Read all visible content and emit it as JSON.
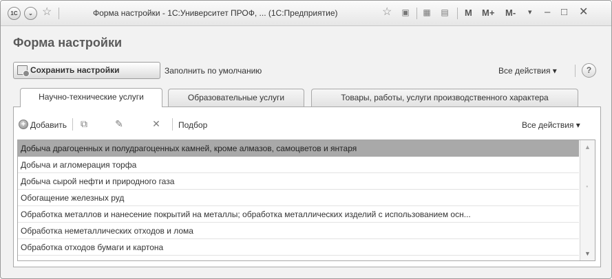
{
  "window": {
    "title": "Форма настройки - 1С:Университет ПРОФ, ... (1С:Предприятие)",
    "logo_text": "1C",
    "icons": [
      "menu-circle-icon",
      "favorite-star-icon",
      "favorite-star-outline-icon",
      "bookmark-icon",
      "calculator-icon",
      "calendar-icon"
    ],
    "memory_buttons": [
      "M",
      "M+",
      "M-"
    ],
    "controls": [
      "dropdown-arrow",
      "minimize",
      "maximize",
      "close"
    ]
  },
  "form": {
    "title": "Форма настройки",
    "save_label": "Сохранить настройки",
    "fill_default_label": "Заполнить по умолчанию",
    "all_actions_label": "Все действия ▾",
    "help_label": "?"
  },
  "tabs": [
    {
      "label": "Научно-технические услуги",
      "active": true
    },
    {
      "label": "Образовательные услуги",
      "active": false
    },
    {
      "label": "Товары, работы, услуги производственного характера",
      "active": false
    }
  ],
  "panel": {
    "add_label": "Добавить",
    "selection_label": "Подбор",
    "all_actions_label": "Все действия ▾"
  },
  "list": {
    "items": [
      {
        "label": "Добыча драгоценных и полудрагоценных камней, кроме алмазов,  самоцветов и янтаря",
        "selected": true
      },
      {
        "label": "Добыча и агломерация торфа",
        "selected": false
      },
      {
        "label": "Добыча сырой нефти и природного газа",
        "selected": false
      },
      {
        "label": "Обогащение железных руд",
        "selected": false
      },
      {
        "label": "Обработка металлов и нанесение покрытий на металлы; обработка  металлических изделий с использованием осн...",
        "selected": false
      },
      {
        "label": "Обработка неметаллических отходов и лома",
        "selected": false
      },
      {
        "label": "Обработка отходов бумаги и картона",
        "selected": false
      }
    ]
  },
  "colors": {
    "selected_row": "#a9a9a9",
    "window_bg": "#f2f2f2",
    "title_text": "#5a5a5a"
  }
}
